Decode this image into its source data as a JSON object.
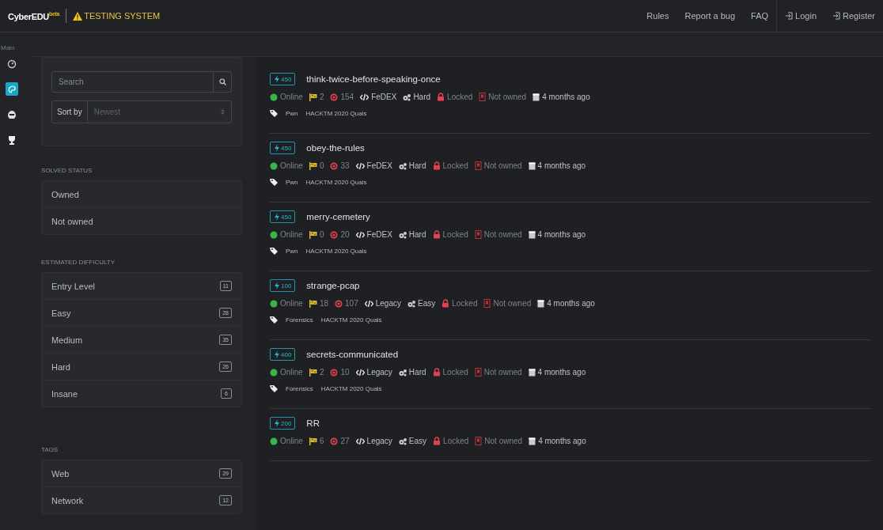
{
  "brand": {
    "name": "CyberEDU",
    "sup": "beta"
  },
  "notice": "TESTING SYSTEM",
  "nav": [
    {
      "label": "Rules",
      "kind": "link"
    },
    {
      "label": "Report a bug",
      "kind": "link"
    },
    {
      "label": "FAQ",
      "kind": "link"
    },
    {
      "label": "Login",
      "kind": "auth"
    },
    {
      "label": "Register",
      "kind": "auth"
    }
  ],
  "rail": {
    "heading": "Main",
    "items": [
      {
        "kind": "dashboard",
        "selected": false
      },
      {
        "kind": "challenges",
        "selected": true
      },
      {
        "kind": "hacker",
        "selected": false
      },
      {
        "kind": "trophy",
        "selected": false
      }
    ]
  },
  "filters": {
    "search": {
      "placeholder": "Search"
    },
    "sort": {
      "label": "Sort by",
      "value": "Newest"
    },
    "groups": [
      {
        "title": "SOLVED STATUS",
        "items": [
          {
            "label": "Owned"
          },
          {
            "label": "Not owned"
          }
        ]
      },
      {
        "title": "ESTIMATED DIFFICULTY",
        "items": [
          {
            "label": "Entry Level",
            "count": "11"
          },
          {
            "label": "Easy",
            "count": "28"
          },
          {
            "label": "Medium",
            "count": "35"
          },
          {
            "label": "Hard",
            "count": "26"
          },
          {
            "label": "Insane",
            "count": "6"
          }
        ]
      },
      {
        "title": "TAGS",
        "items": [
          {
            "label": "Web",
            "count": "29"
          },
          {
            "label": "Network",
            "count": "12"
          }
        ]
      }
    ]
  },
  "challenges": [
    {
      "points": "450",
      "name": "think-twice-before-speaking-once",
      "status": "Online",
      "solves": "2",
      "attempts": "154",
      "engine": "FeDEX",
      "difficulty": "Hard",
      "lock": "Locked",
      "owned": "Not owned",
      "age": "4 months ago",
      "tags": [
        "Pwn",
        "HACKTM 2020 Quals"
      ]
    },
    {
      "points": "450",
      "name": "obey-the-rules",
      "status": "Online",
      "solves": "0",
      "attempts": "33",
      "engine": "FeDEX",
      "difficulty": "Hard",
      "lock": "Locked",
      "owned": "Not owned",
      "age": "4 months ago",
      "tags": [
        "Pwn",
        "HACKTM 2020 Quals"
      ]
    },
    {
      "points": "450",
      "name": "merry-cemetery",
      "status": "Online",
      "solves": "0",
      "attempts": "20",
      "engine": "FeDEX",
      "difficulty": "Hard",
      "lock": "Locked",
      "owned": "Not owned",
      "age": "4 months ago",
      "tags": [
        "Pwn",
        "HACKTM 2020 Quals"
      ]
    },
    {
      "points": "100",
      "name": "strange-pcap",
      "status": "Online",
      "solves": "18",
      "attempts": "107",
      "engine": "Legacy",
      "difficulty": "Easy",
      "lock": "Locked",
      "owned": "Not owned",
      "age": "4 months ago",
      "tags": [
        "Forensics",
        "HACKTM 2020 Quals"
      ]
    },
    {
      "points": "400",
      "name": "secrets-communicated",
      "status": "Online",
      "solves": "2",
      "attempts": "10",
      "engine": "Legacy",
      "difficulty": "Hard",
      "lock": "Locked",
      "owned": "Not owned",
      "age": "4 months ago",
      "tags": [
        "Forensics",
        "HACKTM 2020 Quals"
      ]
    },
    {
      "points": "200",
      "name": "RR",
      "status": "Online",
      "solves": "6",
      "attempts": "27",
      "engine": "Legacy",
      "difficulty": "Easy",
      "lock": "Locked",
      "owned": "Not owned",
      "age": "4 months ago"
    }
  ]
}
